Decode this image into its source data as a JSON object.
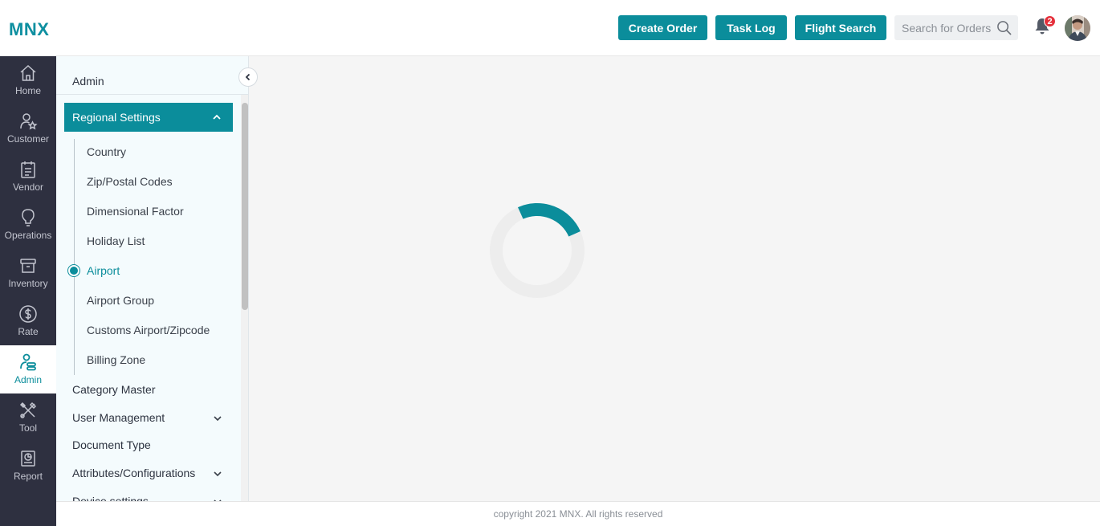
{
  "app": {
    "logo": "MNX"
  },
  "header": {
    "buttons": {
      "create_order": "Create Order",
      "task_log": "Task Log",
      "flight_search": "Flight Search"
    },
    "search": {
      "placeholder": "Search for Orders"
    },
    "notifications": {
      "count": "2"
    },
    "accent_color": "#0b8d9b"
  },
  "rail": {
    "items": [
      {
        "label": "Home",
        "icon": "home-icon"
      },
      {
        "label": "Customer",
        "icon": "customer-star-icon"
      },
      {
        "label": "Vendor",
        "icon": "clipboard-icon"
      },
      {
        "label": "Operations",
        "icon": "lightbulb-icon"
      },
      {
        "label": "Inventory",
        "icon": "box-icon"
      },
      {
        "label": "Rate",
        "icon": "dollar-icon"
      },
      {
        "label": "Admin",
        "icon": "admin-user-icon",
        "active": true
      },
      {
        "label": "Tool",
        "icon": "tools-icon"
      },
      {
        "label": "Report",
        "icon": "report-icon"
      }
    ]
  },
  "sidebar": {
    "title": "Admin",
    "group": {
      "label": "Regional Settings",
      "expanded": true,
      "items": [
        {
          "label": "Country"
        },
        {
          "label": "Zip/Postal Codes"
        },
        {
          "label": "Dimensional Factor"
        },
        {
          "label": "Holiday List"
        },
        {
          "label": "Airport",
          "active": true
        },
        {
          "label": "Airport Group"
        },
        {
          "label": "Customs Airport/Zipcode"
        },
        {
          "label": "Billing Zone"
        }
      ]
    },
    "items": [
      {
        "label": "Category Master",
        "has_children": false
      },
      {
        "label": "User Management",
        "has_children": true
      },
      {
        "label": "Document Type",
        "has_children": false
      },
      {
        "label": "Attributes/Configurations",
        "has_children": true
      },
      {
        "label": "Device settings",
        "has_children": true
      }
    ]
  },
  "main": {
    "loading": true
  },
  "footer": {
    "text": "copyright 2021 MNX. All rights reserved"
  }
}
